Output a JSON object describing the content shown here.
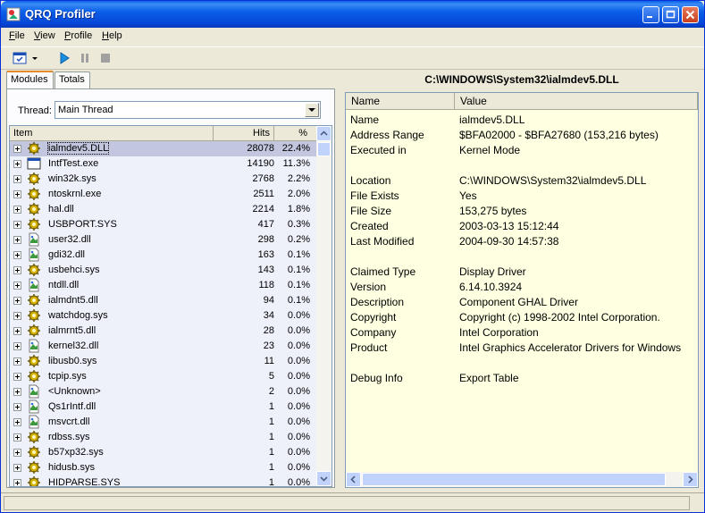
{
  "window": {
    "title": "QRQ Profiler"
  },
  "menu": [
    {
      "label": "File",
      "accel": "F",
      "rest": "ile"
    },
    {
      "label": "View",
      "accel": "V",
      "rest": "iew"
    },
    {
      "label": "Profile",
      "accel": "P",
      "rest": "rofile"
    },
    {
      "label": "Help",
      "accel": "H",
      "rest": "elp"
    }
  ],
  "tabs": {
    "modules": "Modules",
    "totals": "Totals"
  },
  "thread": {
    "label": "Thread:",
    "value": "Main Thread"
  },
  "columns": {
    "item": "Item",
    "hits": "Hits",
    "pct": "%"
  },
  "modules": [
    {
      "name": "ialmdev5.DLL",
      "hits": "28078",
      "pct": "22.4%",
      "icon": "gear"
    },
    {
      "name": "IntfTest.exe",
      "hits": "14190",
      "pct": "11.3%",
      "icon": "window"
    },
    {
      "name": "win32k.sys",
      "hits": "2768",
      "pct": "2.2%",
      "icon": "gear"
    },
    {
      "name": "ntoskrnl.exe",
      "hits": "2511",
      "pct": "2.0%",
      "icon": "gear"
    },
    {
      "name": "hal.dll",
      "hits": "2214",
      "pct": "1.8%",
      "icon": "gear"
    },
    {
      "name": "USBPORT.SYS",
      "hits": "417",
      "pct": "0.3%",
      "icon": "gear"
    },
    {
      "name": "user32.dll",
      "hits": "298",
      "pct": "0.2%",
      "icon": "doc"
    },
    {
      "name": "gdi32.dll",
      "hits": "163",
      "pct": "0.1%",
      "icon": "doc"
    },
    {
      "name": "usbehci.sys",
      "hits": "143",
      "pct": "0.1%",
      "icon": "gear"
    },
    {
      "name": "ntdll.dll",
      "hits": "118",
      "pct": "0.1%",
      "icon": "doc"
    },
    {
      "name": "ialmdnt5.dll",
      "hits": "94",
      "pct": "0.1%",
      "icon": "gear"
    },
    {
      "name": "watchdog.sys",
      "hits": "34",
      "pct": "0.0%",
      "icon": "gear"
    },
    {
      "name": "ialmrnt5.dll",
      "hits": "28",
      "pct": "0.0%",
      "icon": "gear"
    },
    {
      "name": "kernel32.dll",
      "hits": "23",
      "pct": "0.0%",
      "icon": "doc"
    },
    {
      "name": "libusb0.sys",
      "hits": "11",
      "pct": "0.0%",
      "icon": "gear"
    },
    {
      "name": "tcpip.sys",
      "hits": "5",
      "pct": "0.0%",
      "icon": "gear"
    },
    {
      "name": "<Unknown>",
      "hits": "2",
      "pct": "0.0%",
      "icon": "doc"
    },
    {
      "name": "Qs1rIntf.dll",
      "hits": "1",
      "pct": "0.0%",
      "icon": "doc"
    },
    {
      "name": "msvcrt.dll",
      "hits": "1",
      "pct": "0.0%",
      "icon": "doc"
    },
    {
      "name": "rdbss.sys",
      "hits": "1",
      "pct": "0.0%",
      "icon": "gear"
    },
    {
      "name": "b57xp32.sys",
      "hits": "1",
      "pct": "0.0%",
      "icon": "gear"
    },
    {
      "name": "hidusb.sys",
      "hits": "1",
      "pct": "0.0%",
      "icon": "gear"
    },
    {
      "name": "HIDPARSE.SYS",
      "hits": "1",
      "pct": "0.0%",
      "icon": "gear"
    }
  ],
  "detail": {
    "path": "C:\\WINDOWS\\System32\\ialmdev5.DLL",
    "col_name": "Name",
    "col_value": "Value",
    "props": [
      {
        "k": "Name",
        "v": "ialmdev5.DLL"
      },
      {
        "k": "Address Range",
        "v": "$BFA02000 - $BFA27680  (153,216 bytes)"
      },
      {
        "k": "Executed in",
        "v": "Kernel Mode"
      },
      {
        "k": "",
        "v": ""
      },
      {
        "k": "Location",
        "v": "C:\\WINDOWS\\System32\\ialmdev5.DLL"
      },
      {
        "k": "File Exists",
        "v": "Yes"
      },
      {
        "k": "File Size",
        "v": "153,275 bytes"
      },
      {
        "k": "Created",
        "v": "2003-03-13 15:12:44"
      },
      {
        "k": "Last Modified",
        "v": "2004-09-30 14:57:38"
      },
      {
        "k": "",
        "v": ""
      },
      {
        "k": "Claimed Type",
        "v": "Display Driver"
      },
      {
        "k": "Version",
        "v": "6.14.10.3924"
      },
      {
        "k": "Description",
        "v": "Component GHAL Driver"
      },
      {
        "k": "Copyright",
        "v": "Copyright (c) 1998-2002 Intel Corporation."
      },
      {
        "k": "Company",
        "v": "Intel Corporation"
      },
      {
        "k": "Product",
        "v": "Intel Graphics Accelerator Drivers for Windows"
      },
      {
        "k": "",
        "v": ""
      },
      {
        "k": "Debug Info",
        "v": "Export Table"
      }
    ]
  }
}
